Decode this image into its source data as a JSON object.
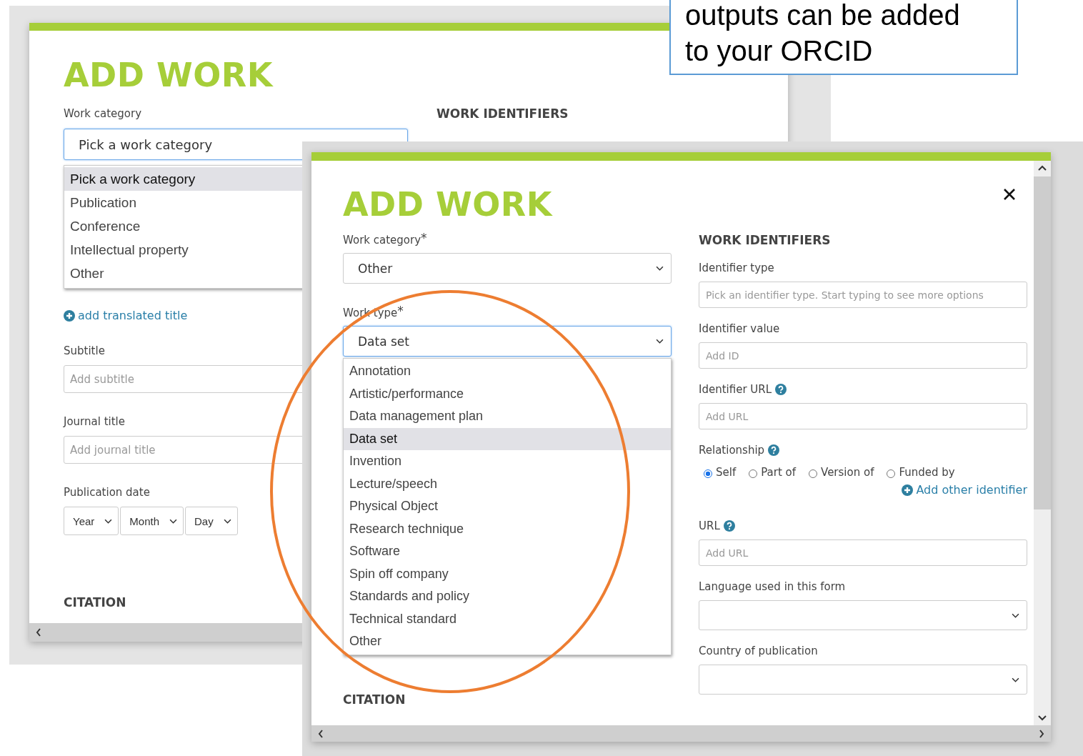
{
  "callout": {
    "lines": [
      "outputs can be added",
      "to your ORCID"
    ]
  },
  "back_dialog": {
    "title": "ADD WORK",
    "identifiers_heading": "WORK IDENTIFIERS",
    "work_category": {
      "label": "Work category",
      "value": "Pick a work category",
      "options": [
        {
          "label": "Pick a work category",
          "selected": true
        },
        {
          "label": "Publication",
          "selected": false
        },
        {
          "label": "Conference",
          "selected": false
        },
        {
          "label": "Intellectual property",
          "selected": false
        },
        {
          "label": "Other",
          "selected": false
        }
      ]
    },
    "translated_title_link": "add translated title",
    "subtitle": {
      "label": "Subtitle",
      "placeholder": "Add subtitle"
    },
    "journal_title": {
      "label": "Journal title",
      "placeholder": "Add journal title"
    },
    "publication_date": {
      "label": "Publication date",
      "selects": [
        "Year",
        "Month",
        "Day"
      ]
    },
    "citation_heading": "CITATION"
  },
  "front_dialog": {
    "title": "ADD WORK",
    "required_mark": "*",
    "work_category": {
      "label": "Work category",
      "value": "Other"
    },
    "work_type": {
      "label": "Work type",
      "value": "Data set",
      "options": [
        {
          "label": "Annotation",
          "selected": false
        },
        {
          "label": "Artistic/performance",
          "selected": false
        },
        {
          "label": "Data management plan",
          "selected": false
        },
        {
          "label": "Data set",
          "selected": true
        },
        {
          "label": "Invention",
          "selected": false
        },
        {
          "label": "Lecture/speech",
          "selected": false
        },
        {
          "label": "Physical Object",
          "selected": false
        },
        {
          "label": "Research technique",
          "selected": false
        },
        {
          "label": "Software",
          "selected": false
        },
        {
          "label": "Spin off company",
          "selected": false
        },
        {
          "label": "Standards and policy",
          "selected": false
        },
        {
          "label": "Technical standard",
          "selected": false
        },
        {
          "label": "Other",
          "selected": false
        }
      ]
    },
    "citation_heading": "CITATION",
    "identifiers_heading": "WORK IDENTIFIERS",
    "fields": [
      {
        "kind": "input",
        "label": "Identifier type",
        "placeholder": "Pick an identifier type. Start typing to see more options",
        "help": false
      },
      {
        "kind": "input",
        "label": "Identifier value",
        "placeholder": "Add ID",
        "help": false
      },
      {
        "kind": "input",
        "label": "Identifier URL",
        "placeholder": "Add URL",
        "help": true
      },
      {
        "kind": "radios",
        "label": "Relationship",
        "help": true,
        "options": [
          {
            "label": "Self",
            "selected": true
          },
          {
            "label": "Part of",
            "selected": false
          },
          {
            "label": "Version of",
            "selected": false
          },
          {
            "label": "Funded by",
            "selected": false
          }
        ]
      },
      {
        "kind": "link",
        "label": "Add other identifier"
      },
      {
        "kind": "input",
        "label": "URL",
        "placeholder": "Add URL",
        "help": true
      },
      {
        "kind": "select",
        "label": "Language used in this form",
        "help": false
      },
      {
        "kind": "select",
        "label": "Country of publication",
        "help": false
      }
    ]
  }
}
